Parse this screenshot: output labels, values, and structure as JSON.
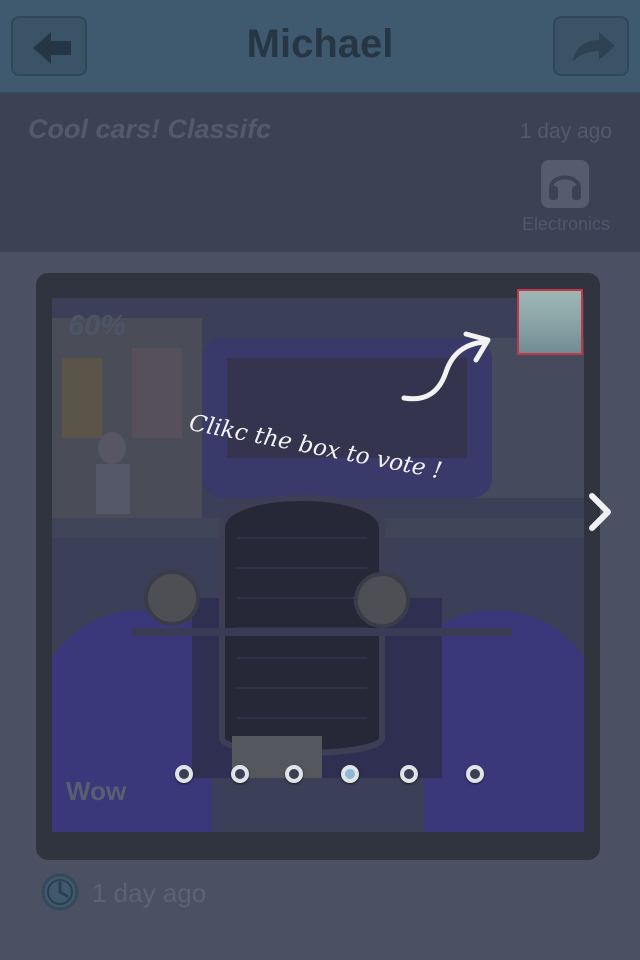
{
  "navbar": {
    "title": "Michael",
    "back_icon": "back-arrow-icon",
    "share_icon": "share-arrow-icon"
  },
  "post": {
    "title": "Cool cars! Classifc",
    "time": "1 day ago",
    "category": {
      "label": "Electronics",
      "icon": "headphones-icon"
    }
  },
  "photo": {
    "percent": "60%",
    "label": "Wow",
    "hint": "Clikc the box to vote !"
  },
  "pager": {
    "count": 6,
    "active_index": 3
  },
  "footer": {
    "time": "1 day ago",
    "icon": "clock-icon"
  },
  "colors": {
    "navbar": "#3f5a6e",
    "vote_box_border": "#c0384a",
    "active_dot": "#8eb6d8"
  }
}
